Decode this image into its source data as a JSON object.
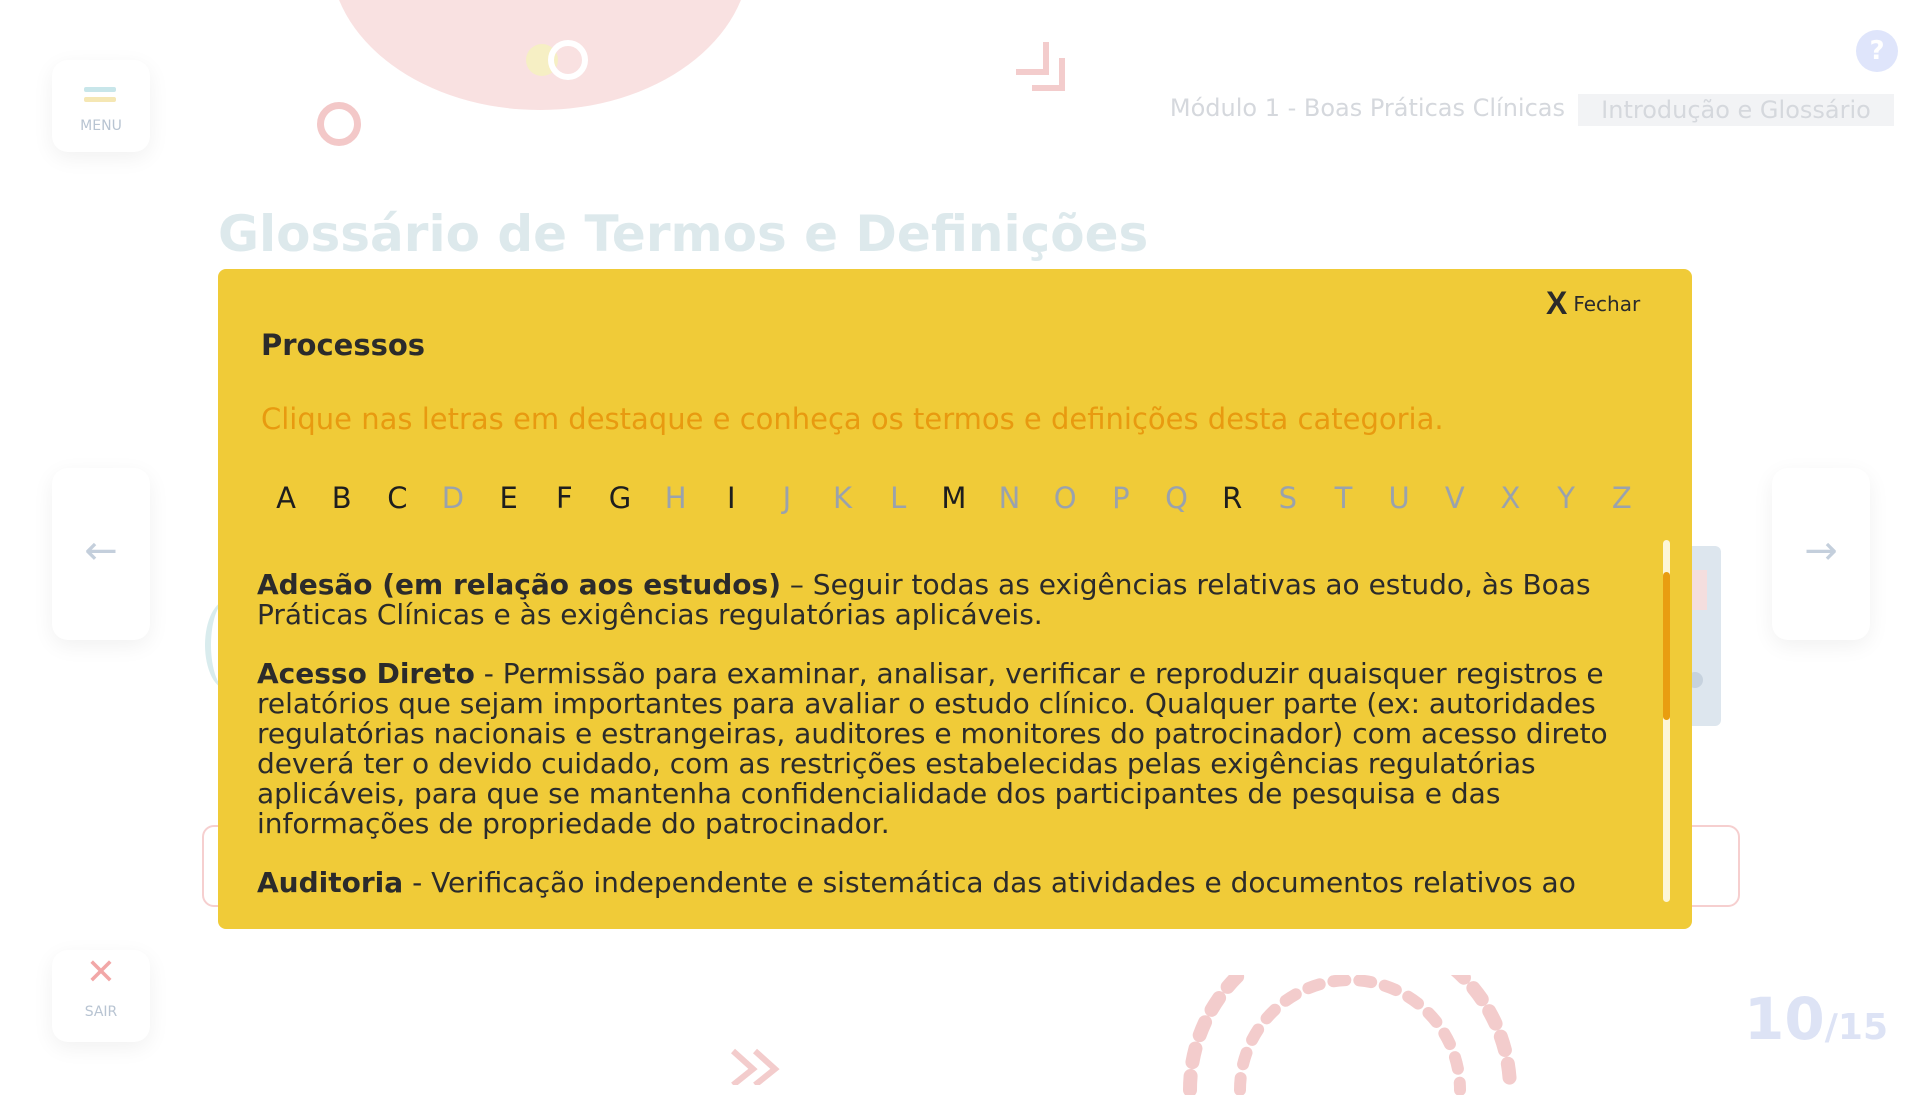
{
  "header": {
    "menu_label": "MENU",
    "help_label": "?",
    "breadcrumb_module": "Módulo 1 - Boas Práticas Clínicas",
    "breadcrumb_section": "Introdução e Glossário"
  },
  "page": {
    "title": "Glossário de Termos e Definições",
    "current": "10",
    "total": "/15"
  },
  "nav": {
    "prev_icon": "arrow-left-icon",
    "next_icon": "arrow-right-icon",
    "exit_icon": "close-icon",
    "exit_label": "SAIR"
  },
  "modal": {
    "close_label": "Fechar",
    "close_icon": "X",
    "title": "Processos",
    "instruction": "Clique nas letras em destaque e conheça os termos e definições desta categoria.",
    "letters": [
      {
        "char": "A",
        "active": true
      },
      {
        "char": "B",
        "active": true
      },
      {
        "char": "C",
        "active": true
      },
      {
        "char": "D",
        "active": false
      },
      {
        "char": "E",
        "active": true
      },
      {
        "char": "F",
        "active": true
      },
      {
        "char": "G",
        "active": true
      },
      {
        "char": "H",
        "active": false
      },
      {
        "char": "I",
        "active": true
      },
      {
        "char": "J",
        "active": false
      },
      {
        "char": "K",
        "active": false
      },
      {
        "char": "L",
        "active": false
      },
      {
        "char": "M",
        "active": true
      },
      {
        "char": "N",
        "active": false
      },
      {
        "char": "O",
        "active": false
      },
      {
        "char": "P",
        "active": false
      },
      {
        "char": "Q",
        "active": false
      },
      {
        "char": "R",
        "active": true
      },
      {
        "char": "S",
        "active": false
      },
      {
        "char": "T",
        "active": false
      },
      {
        "char": "U",
        "active": false
      },
      {
        "char": "V",
        "active": false
      },
      {
        "char": "X",
        "active": false
      },
      {
        "char": "Y",
        "active": false
      },
      {
        "char": "Z",
        "active": false
      }
    ],
    "entries": [
      {
        "term": "Adesão (em relação aos estudos)",
        "definition": " – Seguir todas as exigências relativas ao estudo, às Boas Práticas Clínicas e às exigências regulatórias aplicáveis."
      },
      {
        "term": "Acesso Direto",
        "definition": " - Permissão para examinar, analisar, verificar e reproduzir quaisquer registros e relatórios que sejam importantes para avaliar o estudo clínico. Qualquer parte (ex: autoridades regulatórias nacionais e estrangeiras, auditores e monitores do patrocinador) com acesso direto deverá ter o devido cuidado, com as restrições estabelecidas pelas exigências regulatórias aplicáveis, para que se mantenha confidencialidade dos participantes de pesquisa e das informações de propriedade do patrocinador."
      },
      {
        "term": "Auditoria",
        "definition": " - Verificação independente e sistemática das atividades e documentos relativos ao"
      }
    ]
  },
  "colors": {
    "modal_bg": "#f0cb38",
    "instruction": "#e89a10",
    "scroll_thumb": "#e99d10",
    "letter_inactive": "#9aa2ad"
  }
}
